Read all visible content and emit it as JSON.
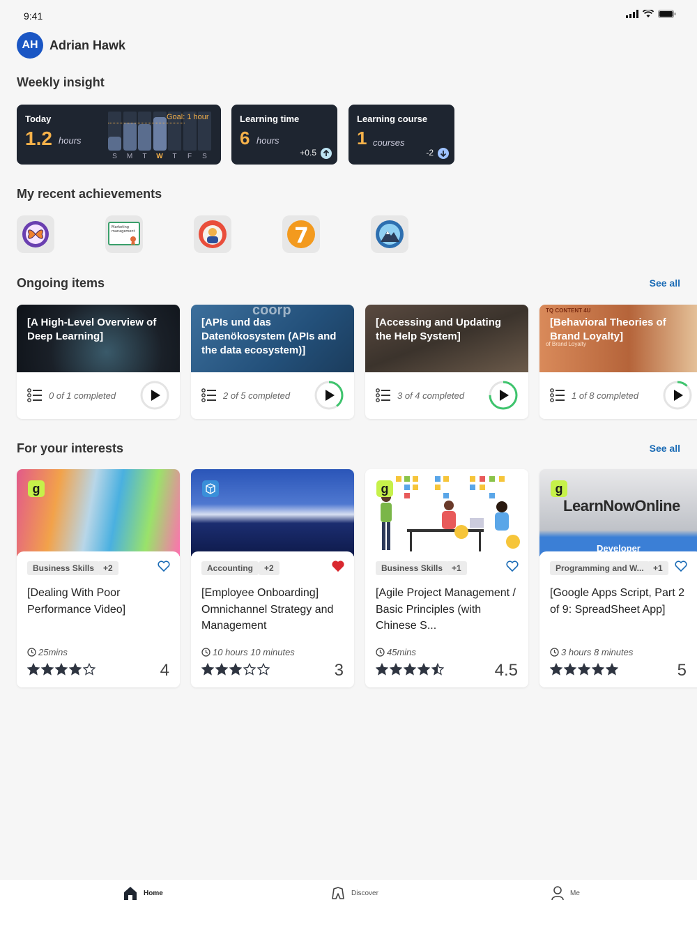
{
  "status": {
    "time": "9:41"
  },
  "user": {
    "initials": "AH",
    "name": "Adrian Hawk"
  },
  "sections": {
    "weekly": "Weekly insight",
    "achievements": "My recent achievements",
    "ongoing": "Ongoing items",
    "interests": "For your interests",
    "see_all": "See all"
  },
  "insights": {
    "today": {
      "label": "Today",
      "value": "1.2",
      "unit": "hours",
      "goal": "Goal: 1 hour",
      "days": [
        "S",
        "M",
        "T",
        "W",
        "T",
        "F",
        "S"
      ],
      "highlight_day_index": 3,
      "day_values": [
        0.5,
        1.0,
        0.95,
        1.2,
        0,
        0,
        0
      ],
      "goal_value": 1.0
    },
    "learning_time": {
      "label": "Learning time",
      "value": "6",
      "unit": "hours",
      "delta": "+0.5"
    },
    "learning_course": {
      "label": "Learning course",
      "value": "1",
      "unit": "courses",
      "delta": "-2"
    }
  },
  "achievements": [
    {
      "icon": "butterfly-badge-icon"
    },
    {
      "icon": "marketing-certificate-icon",
      "text": "Marketing management"
    },
    {
      "icon": "quiz-master-badge-icon"
    },
    {
      "icon": "seven-days-streak-icon",
      "text": "7"
    },
    {
      "icon": "mount-everest-badge-icon"
    }
  ],
  "ongoing": [
    {
      "title": "[A High-Level Overview of Deep Learning]",
      "progress": "0 of 1 completed",
      "fraction": 0.0,
      "bg": "#1a2028"
    },
    {
      "title": "[APIs und das Datenökosystem (APIs and the data ecosystem)]",
      "progress": "2 of 5 completed",
      "fraction": 0.4,
      "bg": "#2c5c88",
      "watermark": "coorp"
    },
    {
      "title": "[Accessing and Updating the Help System]",
      "progress": "3 of 4 completed",
      "fraction": 0.75,
      "bg": "#4a4038"
    },
    {
      "title": "[Behavioral Theories of Brand Loyalty]",
      "progress": "1 of 8 completed",
      "fraction": 0.125,
      "bg": "#c87a4a",
      "provider": "TQ CONTENT 4U",
      "sub": "of Brand Loyalty"
    }
  ],
  "interests": [
    {
      "tags": [
        "Business Skills",
        "+2"
      ],
      "title": "[Dealing With Poor Performance Video]",
      "duration": "25mins",
      "rating": "4",
      "stars": 4,
      "liked": false,
      "provider": "g"
    },
    {
      "tags": [
        "Accounting",
        "+2"
      ],
      "title": "[Employee Onboarding] Omnichannel Strategy and Management",
      "duration": "10 hours 10 minutes",
      "rating": "3",
      "stars": 3,
      "liked": true,
      "provider": "box"
    },
    {
      "tags": [
        "Business Skills",
        "+1"
      ],
      "title": "[Agile Project Management / Basic Principles (with Chinese S...",
      "duration": "45mins",
      "rating": "4.5",
      "stars": 4.5,
      "liked": false,
      "provider": "g"
    },
    {
      "tags": [
        "Programming and W...",
        "+1"
      ],
      "title": "[Google Apps Script, Part 2 of 9: SpreadSheet App]",
      "duration": "3 hours 8 minutes",
      "rating": "5",
      "stars": 5,
      "liked": false,
      "provider": "g",
      "thumb_brand": "LearnNowOnline",
      "thumb_sub": "Developer"
    }
  ],
  "nav": {
    "home": "Home",
    "discover": "Discover",
    "me": "Me"
  },
  "colors": {
    "accent": "#1a6bb5",
    "gold": "#f5b14a",
    "progress": "#3ec46d",
    "heart_red": "#d9282f"
  }
}
